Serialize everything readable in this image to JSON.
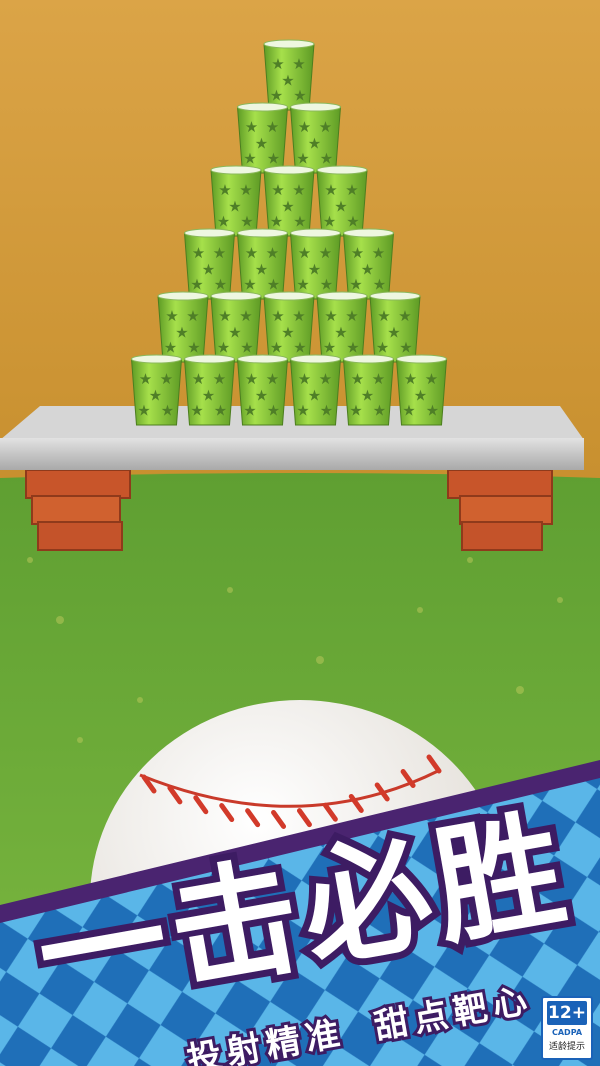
{
  "banner": {
    "headline": "一击必胜",
    "tagline_left": "投射精准",
    "tagline_right": "甜点靶心"
  },
  "rating_badge": {
    "age": "12+",
    "org": "CADPA",
    "tip": "适龄提示"
  },
  "scene": {
    "cup_rows": [
      1,
      2,
      3,
      4,
      5,
      6
    ],
    "colors": {
      "wall": "#d9a23f",
      "grass": "#6fae3c",
      "cup": "#8fd43a",
      "cup_star": "#4f7f27",
      "table": "#cfcfcf",
      "brick": "#c9552a",
      "banner_purple": "#4a2470",
      "banner_diamond_light": "#5ab6e8",
      "banner_diamond_dark": "#1f6fb8"
    }
  }
}
